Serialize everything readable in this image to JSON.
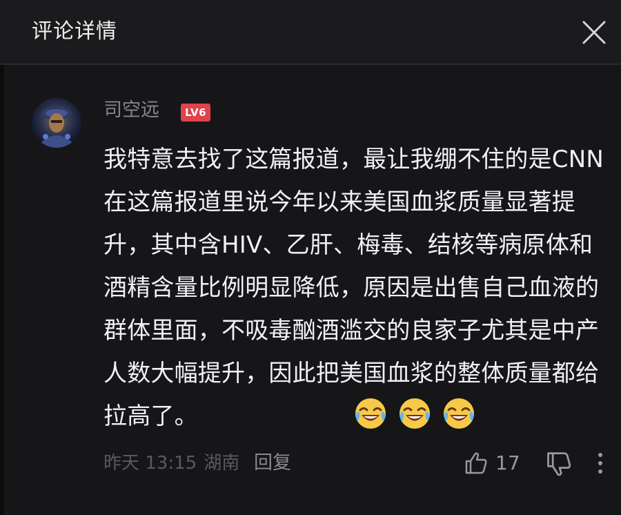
{
  "header": {
    "title": "评论详情"
  },
  "comment": {
    "username": "司空远",
    "level_badge": "LV6",
    "text": "我特意去找了这篇报道，最让我绷不住的是CNN在这篇报道里说今年以来美国血浆质量显著提升，其中含HIV、乙肝、梅毒、结核等病原体和酒精含量比例明显降低，原因是出售自己血液的群体里面，不吸毒酗酒滥交的良家子尤其是中产人数大幅提升，因此把美国血浆的整体质量都给拉高了。",
    "emojis": [
      "laugh-cry",
      "laugh-cry",
      "laugh-cry"
    ],
    "time": "昨天 13:15",
    "location": "湖南",
    "reply_label": "回复",
    "like_count": "17"
  },
  "colors": {
    "background": "#161618",
    "header_bg": "#1b1b1d",
    "text_primary": "#f1f1f3",
    "text_muted": "#86868a",
    "badge_red": "#e0434a"
  }
}
